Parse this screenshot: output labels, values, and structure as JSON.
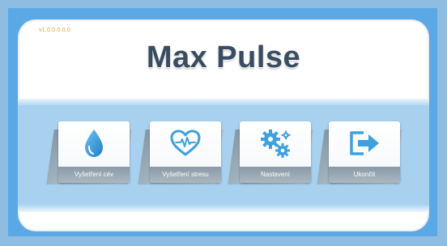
{
  "app": {
    "version": "v1.0.0.0.0.0",
    "title": "Max Pulse"
  },
  "menu": {
    "items": [
      {
        "label": "Vyšetření cév",
        "icon": "water-drop-icon"
      },
      {
        "label": "Vyšetření stresu",
        "icon": "heart-pulse-icon"
      },
      {
        "label": "Nastavení",
        "icon": "gears-icon"
      },
      {
        "label": "Ukončit",
        "icon": "exit-icon"
      }
    ]
  },
  "colors": {
    "background": "#8fbde2",
    "frame": "#5aa9e6",
    "band": "#a7d1ef",
    "accent_icon": "#3ea1df",
    "title": "#3a4c61",
    "version": "#e0a030"
  }
}
